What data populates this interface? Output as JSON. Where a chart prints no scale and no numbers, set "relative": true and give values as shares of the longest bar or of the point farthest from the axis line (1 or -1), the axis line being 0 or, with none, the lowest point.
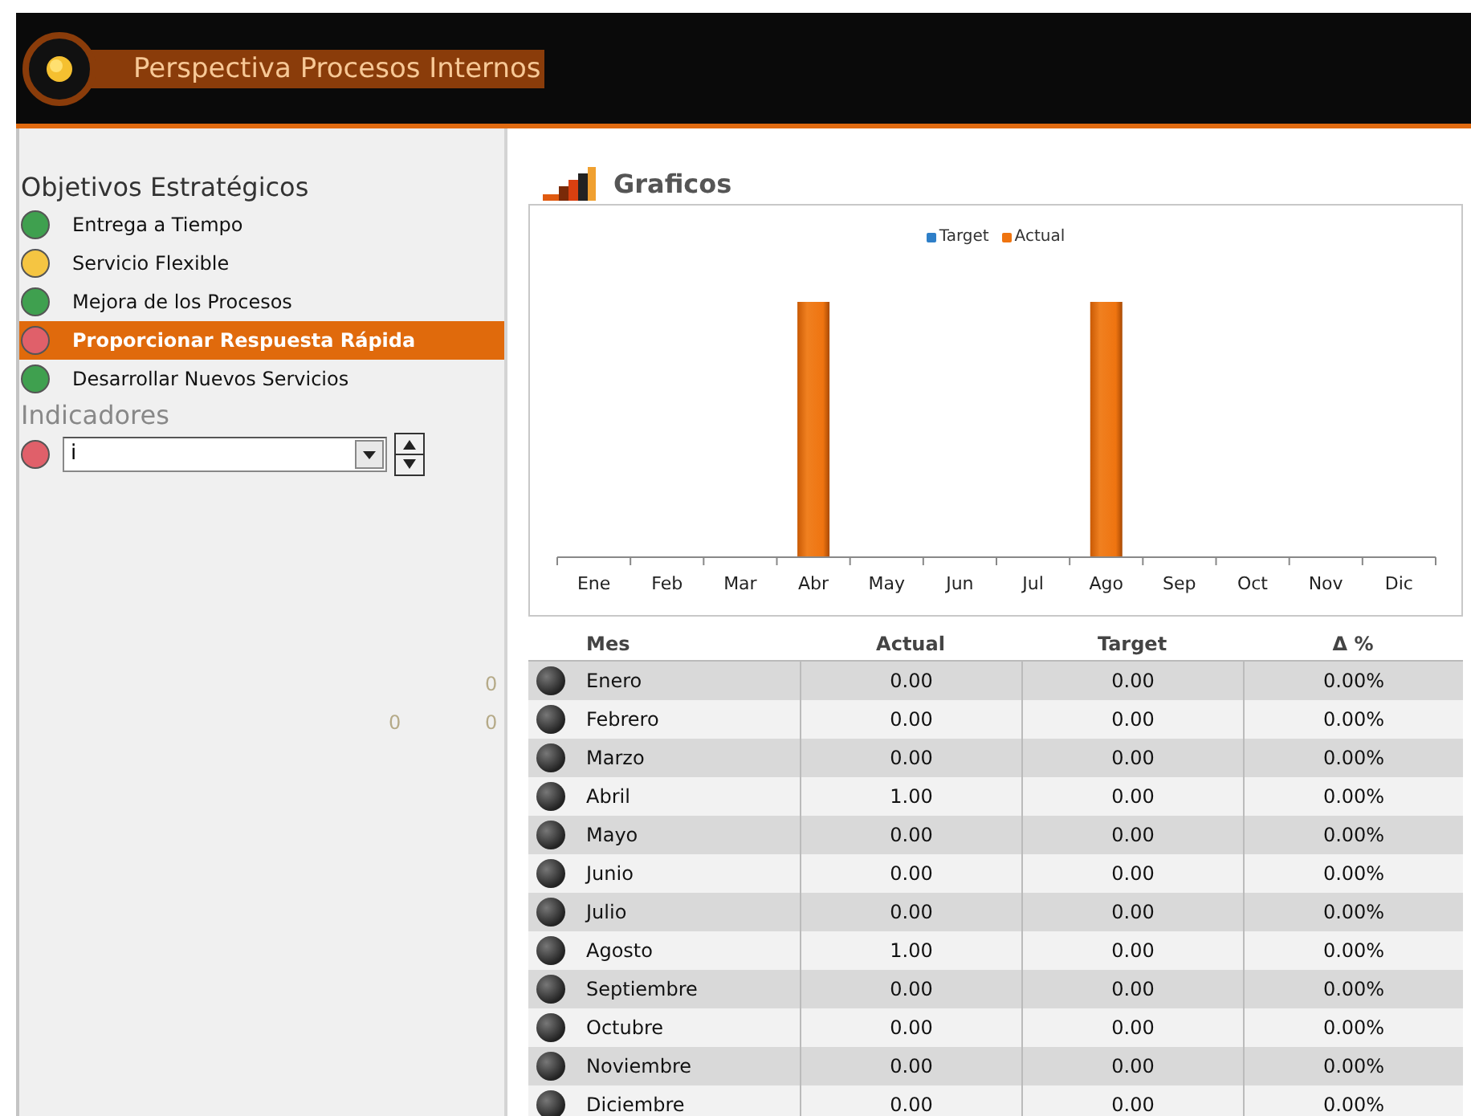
{
  "header": {
    "title": "Perspectiva Procesos Internos"
  },
  "sidebar": {
    "objectives_title": "Objetivos Estratégicos",
    "objectives": [
      {
        "label": "Entrega a Tiempo",
        "color": "#3fa04f",
        "selected": false
      },
      {
        "label": "Servicio Flexible",
        "color": "#f5c542",
        "selected": false
      },
      {
        "label": "Mejora de los Procesos",
        "color": "#3fa04f",
        "selected": false
      },
      {
        "label": "Proporcionar Respuesta Rápida",
        "color": "#e0606a",
        "selected": true
      },
      {
        "label": "Desarrollar Nuevos Servicios",
        "color": "#3fa04f",
        "selected": false
      }
    ],
    "indicators_title": "Indicadores",
    "indicator": {
      "color": "#e0606a",
      "value": "i"
    },
    "faint_values": [
      "0",
      "0",
      "0"
    ]
  },
  "charts_title": "Graficos",
  "chart": {
    "chart_data": {
      "type": "bar",
      "relative": true,
      "categories": [
        "Ene",
        "Feb",
        "Mar",
        "Abr",
        "May",
        "Jun",
        "Jul",
        "Ago",
        "Sep",
        "Oct",
        "Nov",
        "Dic"
      ],
      "series": [
        {
          "name": "Target",
          "color": "#2e7fc8",
          "values": [
            0,
            0,
            0,
            0,
            0,
            0,
            0,
            0,
            0,
            0,
            0,
            0
          ]
        },
        {
          "name": "Actual",
          "color": "#ef7410",
          "values": [
            0,
            0,
            0,
            1,
            0,
            0,
            0,
            1,
            0,
            0,
            0,
            0
          ]
        }
      ]
    }
  },
  "table": {
    "columns": [
      "Mes",
      "Actual",
      "Target",
      "Δ %"
    ],
    "rows": [
      [
        "Enero",
        "0.00",
        "0.00",
        "0.00%"
      ],
      [
        "Febrero",
        "0.00",
        "0.00",
        "0.00%"
      ],
      [
        "Marzo",
        "0.00",
        "0.00",
        "0.00%"
      ],
      [
        "Abril",
        "1.00",
        "0.00",
        "0.00%"
      ],
      [
        "Mayo",
        "0.00",
        "0.00",
        "0.00%"
      ],
      [
        "Junio",
        "0.00",
        "0.00",
        "0.00%"
      ],
      [
        "Julio",
        "0.00",
        "0.00",
        "0.00%"
      ],
      [
        "Agosto",
        "1.00",
        "0.00",
        "0.00%"
      ],
      [
        "Septiembre",
        "0.00",
        "0.00",
        "0.00%"
      ],
      [
        "Octubre",
        "0.00",
        "0.00",
        "0.00%"
      ],
      [
        "Noviembre",
        "0.00",
        "0.00",
        "0.00%"
      ],
      [
        "Diciembre",
        "0.00",
        "0.00",
        "0.00%"
      ]
    ]
  }
}
